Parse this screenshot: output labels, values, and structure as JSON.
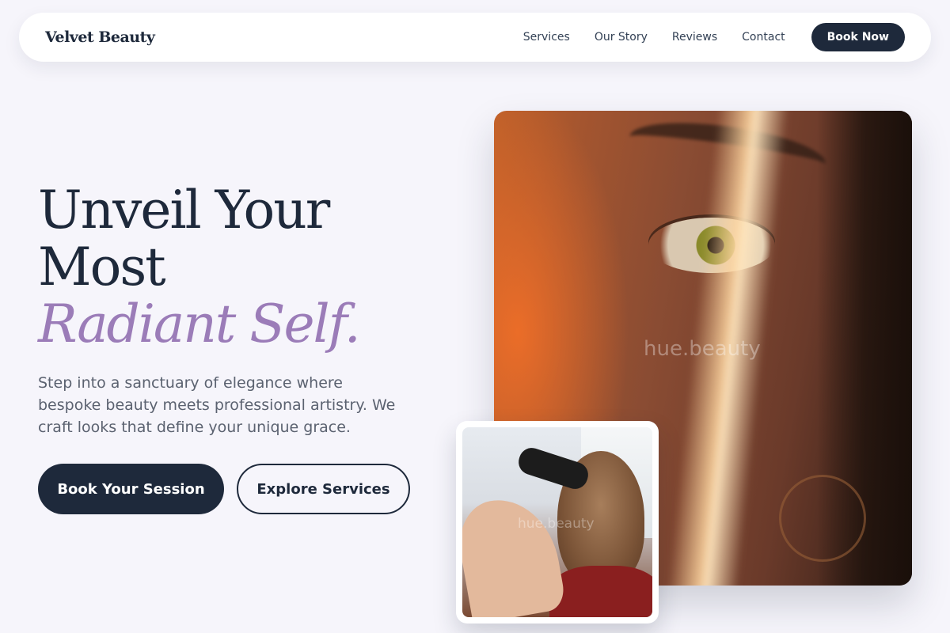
{
  "brand": {
    "name": "Velvet Beauty"
  },
  "nav": {
    "links": [
      {
        "label": "Services"
      },
      {
        "label": "Our Story"
      },
      {
        "label": "Reviews"
      },
      {
        "label": "Contact"
      }
    ],
    "cta_label": "Book Now"
  },
  "hero": {
    "title_line1": "Unveil Your",
    "title_line2": "Most",
    "title_accent": "Radiant Self.",
    "subtitle": "Step into a sanctuary of elegance where bespoke beauty meets professional artistry. We craft looks that define your unique grace.",
    "primary_button": "Book Your Session",
    "secondary_button": "Explore Services"
  },
  "images": {
    "main_watermark": "hue.beauty",
    "secondary_watermark": "hue.beauty"
  },
  "colors": {
    "background": "#f6f5fb",
    "primary": "#1e293b",
    "accent": "#9b7cb8",
    "text_muted": "#5b6270"
  }
}
